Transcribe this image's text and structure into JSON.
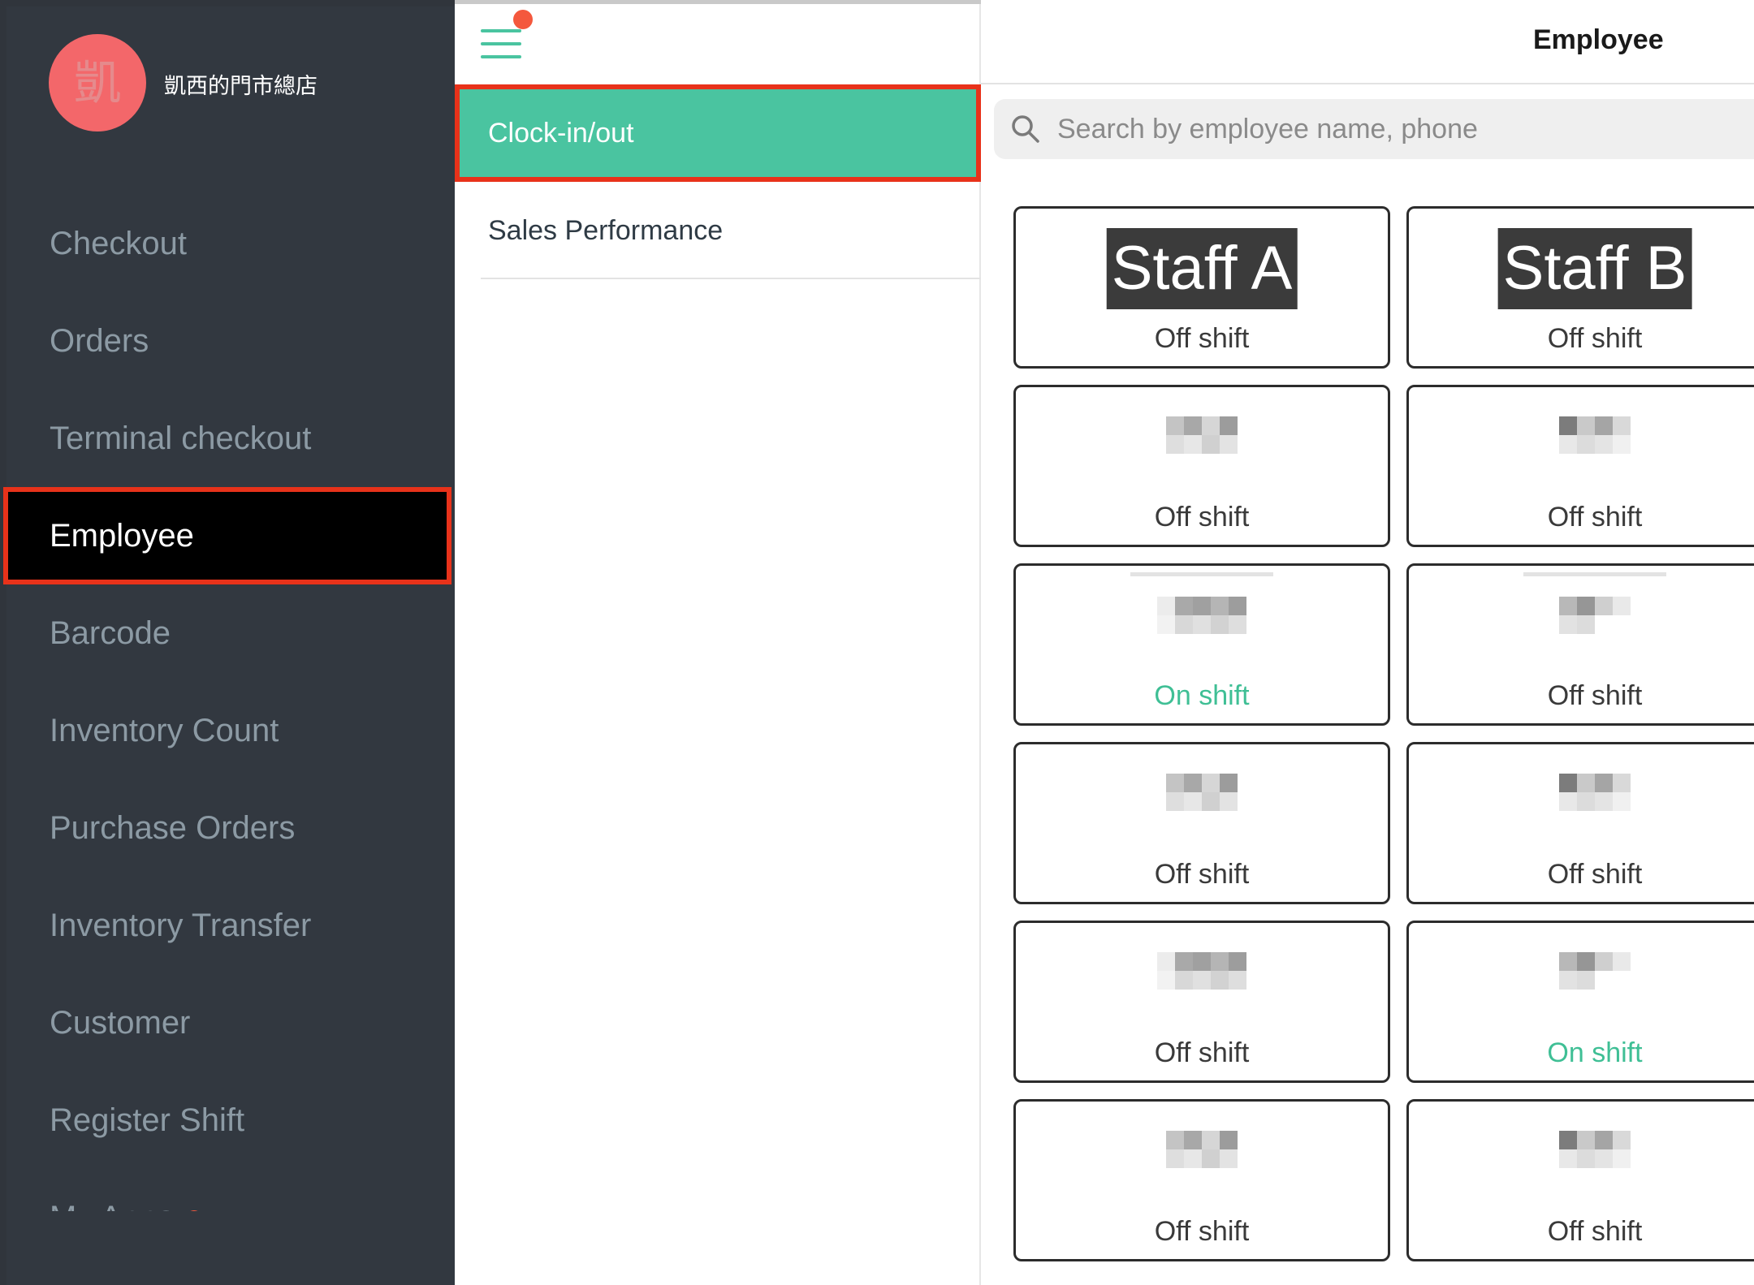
{
  "sidebar": {
    "store_avatar": "凱",
    "store_name": "凱西的門市總店",
    "items": [
      {
        "label": "Checkout",
        "name": "sidebar-item-checkout",
        "active": false
      },
      {
        "label": "Orders",
        "name": "sidebar-item-orders",
        "active": false
      },
      {
        "label": "Terminal checkout",
        "name": "sidebar-item-terminal-checkout",
        "active": false
      },
      {
        "label": "Employee",
        "name": "sidebar-item-employee",
        "active": true
      },
      {
        "label": "Barcode",
        "name": "sidebar-item-barcode",
        "active": false
      },
      {
        "label": "Inventory Count",
        "name": "sidebar-item-inventory-count",
        "active": false
      },
      {
        "label": "Purchase Orders",
        "name": "sidebar-item-purchase-orders",
        "active": false
      },
      {
        "label": "Inventory Transfer",
        "name": "sidebar-item-inventory-transfer",
        "active": false
      },
      {
        "label": "Customer",
        "name": "sidebar-item-customer",
        "active": false
      },
      {
        "label": "Register Shift",
        "name": "sidebar-item-register-shift",
        "active": false
      },
      {
        "label": "My Apps",
        "name": "sidebar-item-my-apps",
        "active": false,
        "badge_dot": true
      }
    ]
  },
  "middle": {
    "menu_icon": "hamburger-icon",
    "sub_items": [
      {
        "label": "Clock-in/out",
        "name": "subnav-clock-in-out",
        "active": true
      },
      {
        "label": "Sales Performance",
        "name": "subnav-sales-performance",
        "active": false
      }
    ]
  },
  "header": {
    "title": "Employee"
  },
  "search": {
    "icon": "search-icon",
    "placeholder": "Search by employee name, phone",
    "value": ""
  },
  "employees": [
    {
      "name": "Staff A",
      "status": "Off shift",
      "on_shift": false,
      "blurred": false
    },
    {
      "name": "Staff B",
      "status": "Off shift",
      "on_shift": false,
      "blurred": false
    },
    {
      "name": "",
      "status": "Off shift",
      "on_shift": false,
      "blurred": true
    },
    {
      "name": "",
      "status": "Off shift",
      "on_shift": false,
      "blurred": true
    },
    {
      "name": "",
      "status": "On shift",
      "on_shift": true,
      "blurred": true
    },
    {
      "name": "",
      "status": "Off shift",
      "on_shift": false,
      "blurred": true
    },
    {
      "name": "",
      "status": "Off shift",
      "on_shift": false,
      "blurred": true
    },
    {
      "name": "",
      "status": "Off shift",
      "on_shift": false,
      "blurred": true
    },
    {
      "name": "",
      "status": "Off shift",
      "on_shift": false,
      "blurred": true
    },
    {
      "name": "",
      "status": "On shift",
      "on_shift": true,
      "blurred": true
    },
    {
      "name": "",
      "status": "Off shift",
      "on_shift": false,
      "blurred": true
    },
    {
      "name": "",
      "status": "Off shift",
      "on_shift": false,
      "blurred": true
    }
  ],
  "colors": {
    "accent": "#4ac4a0",
    "highlight_border": "#e8321a",
    "sidebar_bg": "#323840",
    "on_shift": "#3fbf95",
    "notification_dot": "#f4583d",
    "avatar_bg": "#f3676a"
  }
}
